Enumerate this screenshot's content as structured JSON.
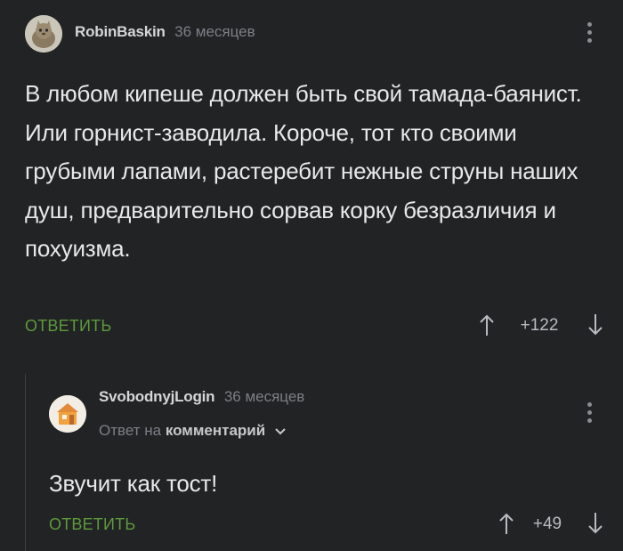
{
  "comments": [
    {
      "author": "RobinBaskin",
      "time": "36 месяцев",
      "text": "В любом кипеше должен быть свой тамада-баянист. Или горнист-заводила. Короче, тот кто своими грубыми лапами, растеребит нежные струны наших душ, предварительно сорвав корку безразличия и похуизма.",
      "reply_label": "ОТВЕТИТЬ",
      "score": "+122",
      "avatar_icon": "cat-avatar-icon"
    },
    {
      "author": "SvobodnyjLogin",
      "time": "36 месяцев",
      "reply_to_prefix": "Ответ на",
      "reply_to_target": "комментарий",
      "text": "Звучит как тост!",
      "reply_label": "ОТВЕТИТЬ",
      "score": "+49",
      "avatar_icon": "house-avatar-icon"
    }
  ],
  "colors": {
    "background": "#222325",
    "reply_button": "#5d9a3b",
    "muted_text": "#7c7f84",
    "thread_line": "#3d4043"
  },
  "icons": {
    "menu": "more-vertical-icon",
    "upvote": "arrow-up-icon",
    "downvote": "arrow-down-icon",
    "expand": "chevron-down-icon"
  }
}
